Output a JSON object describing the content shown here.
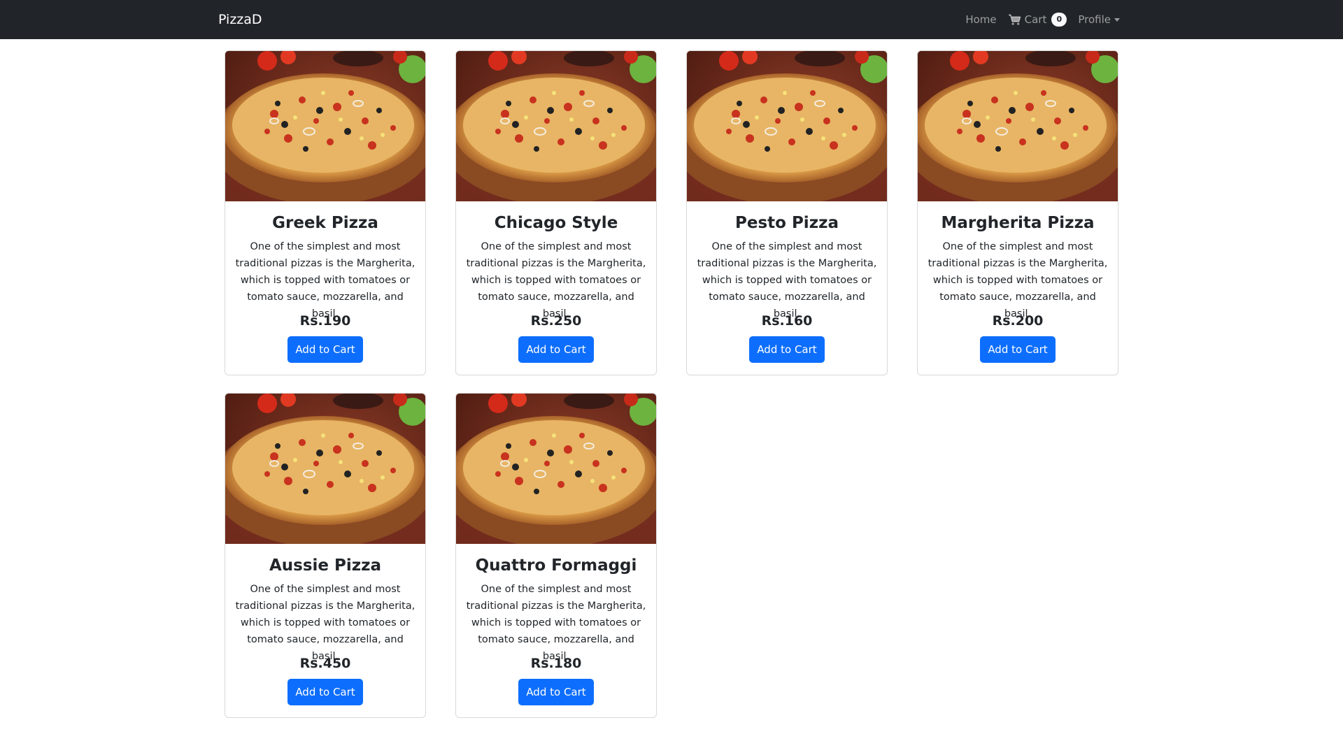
{
  "navbar": {
    "brand": "PizzaD",
    "home_label": "Home",
    "cart_label": "Cart",
    "cart_count": "0",
    "profile_label": "Profile",
    "icons": {
      "cart": "shopping-cart-icon",
      "dropdown": "caret-down-icon"
    }
  },
  "products": [
    {
      "name": "Greek Pizza",
      "description": "One of the simplest and most traditional pizzas is the Margherita, which is topped with tomatoes or tomato sauce, mozzarella, and basil.",
      "price": "Rs.190",
      "button_label": "Add to Cart"
    },
    {
      "name": "Chicago Style",
      "description": "One of the simplest and most traditional pizzas is the Margherita, which is topped with tomatoes or tomato sauce, mozzarella, and basil.",
      "price": "Rs.250",
      "button_label": "Add to Cart"
    },
    {
      "name": "Pesto Pizza",
      "description": "One of the simplest and most traditional pizzas is the Margherita, which is topped with tomatoes or tomato sauce, mozzarella, and basil.",
      "price": "Rs.160",
      "button_label": "Add to Cart"
    },
    {
      "name": "Margherita Pizza",
      "description": "One of the simplest and most traditional pizzas is the Margherita, which is topped with tomatoes or tomato sauce, mozzarella, and basil.",
      "price": "Rs.200",
      "button_label": "Add to Cart"
    },
    {
      "name": "Aussie Pizza",
      "description": "One of the simplest and most traditional pizzas is the Margherita, which is topped with tomatoes or tomato sauce, mozzarella, and basil.",
      "price": "Rs.450",
      "button_label": "Add to Cart"
    },
    {
      "name": "Quattro Formaggi",
      "description": "One of the simplest and most traditional pizzas is the Margherita, which is topped with tomatoes or tomato sauce, mozzarella, and basil.",
      "price": "Rs.180",
      "button_label": "Add to Cart"
    }
  ],
  "colors": {
    "navbar_bg": "#212529",
    "primary_button": "#0d6efd",
    "text": "#212529"
  }
}
